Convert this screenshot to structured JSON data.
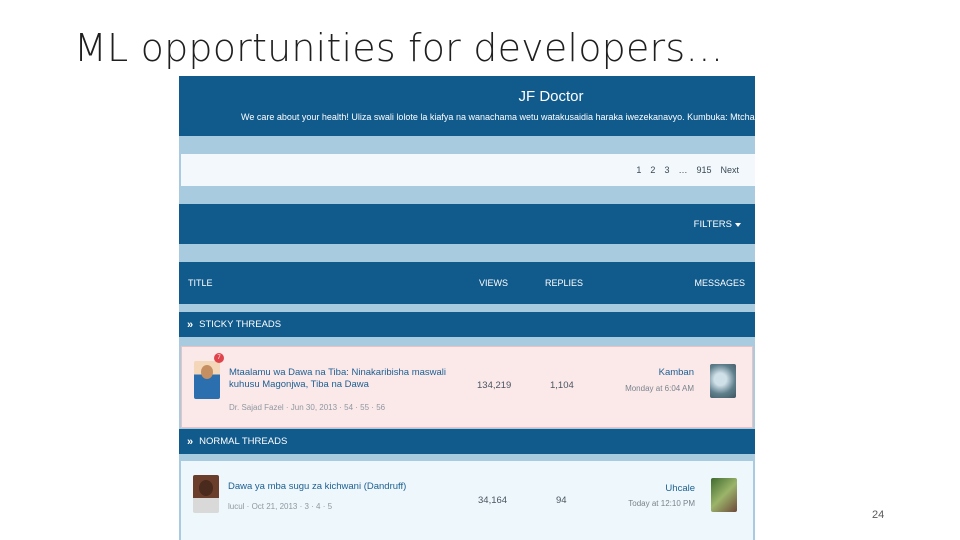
{
  "slide": {
    "title": "ML opportunities for developers…",
    "page_number": "24"
  },
  "forum": {
    "site_title": "JF Doctor",
    "tagline": "We care about your health! Uliza swali lolote la kiafya na wanachama wetu watakusaidia haraka iwezekanavyo. Kumbuka: Mtcha",
    "pagination": [
      "1",
      "2",
      "3",
      "…",
      "915",
      "Next"
    ],
    "filters_label": "FILTERS",
    "columns": {
      "title": "TITLE",
      "views": "VIEWS",
      "replies": "REPLIES",
      "messages": "MESSAGES"
    },
    "sticky_section": "STICKY THREADS",
    "normal_section": "NORMAL THREADS",
    "sticky_thread": {
      "badge": "7",
      "title_line1": "Mtaalamu wa Dawa na Tiba: Ninakaribisha maswali",
      "title_line2": "kuhusu Magonjwa, Tiba na Dawa",
      "meta": "Dr. Sajad Fazel · Jun 30, 2013 · 54 · 55 · 56",
      "views": "134,219",
      "replies": "1,104",
      "last_user": "Kamban",
      "last_time": "Monday at 6:04 AM"
    },
    "normal_thread": {
      "title": "Dawa ya mba sugu za kichwani (Dandruff)",
      "meta": "lucul · Oct 21, 2013 · 3 · 4 · 5",
      "views": "34,164",
      "replies": "94",
      "last_user": "Uhcale",
      "last_time": "Today at 12:10 PM"
    }
  },
  "colors": {
    "header_blue": "#115a8c",
    "page_bg": "#a9cbe0",
    "sticky_row_bg": "#fbe9ea",
    "link_blue": "#1c5f91"
  }
}
